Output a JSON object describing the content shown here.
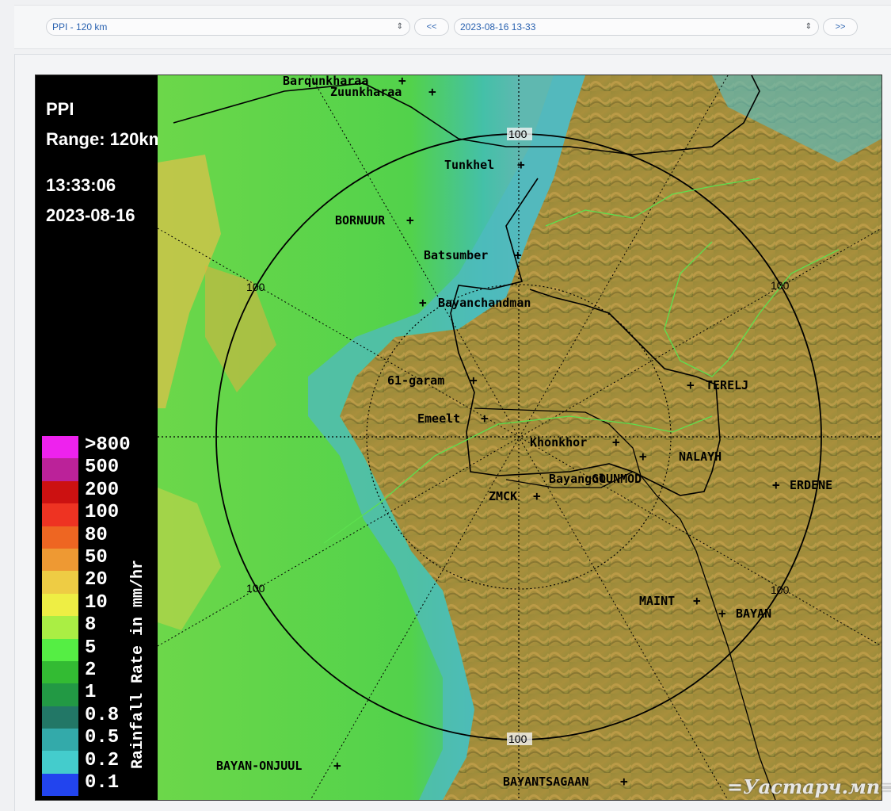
{
  "toolbar": {
    "product_select": "PPI - 120 km",
    "prev_label": "<<",
    "time_select": "2023-08-16 13-33",
    "next_label": ">>"
  },
  "radar": {
    "product": "PPI",
    "range": "Range: 120km",
    "time": "13:33:06",
    "date": "2023-08-16"
  },
  "legend": {
    "title": "Rainfall Rate in mm/hr",
    "labels": [
      ">800",
      "500",
      "200",
      "100",
      "80",
      "50",
      "20",
      "10",
      "8",
      "5",
      "2",
      "1",
      "0.8",
      "0.5",
      "0.2",
      "0.1"
    ],
    "colors": [
      "#ee22ee",
      "#bb2299",
      "#cc1111",
      "#ee3322",
      "#ee6622",
      "#ee9933",
      "#eecc44",
      "#eeee44",
      "#aaee44",
      "#55ee44",
      "#33bb33",
      "#229944",
      "#227766",
      "#33aaaa",
      "#44cccc",
      "#2244ee"
    ]
  },
  "map": {
    "ring_label": "100",
    "places": [
      "Barqunkharaa",
      "Zuunkharaa",
      "Tunkhel",
      "BORNUUR",
      "Batsumber",
      "Bayanchandman",
      "61-garam",
      "Emeelt",
      "Khonkhor",
      "NALAYH",
      "TERELJ",
      "ERDENE",
      "Bayangol",
      "GOUNMOD",
      "ZMCK",
      "MAINT",
      "BAYAN",
      "BAYAN-ONJUUL",
      "BAYANTSAGAAN"
    ]
  },
  "watermark": "=Уастарч.мп="
}
